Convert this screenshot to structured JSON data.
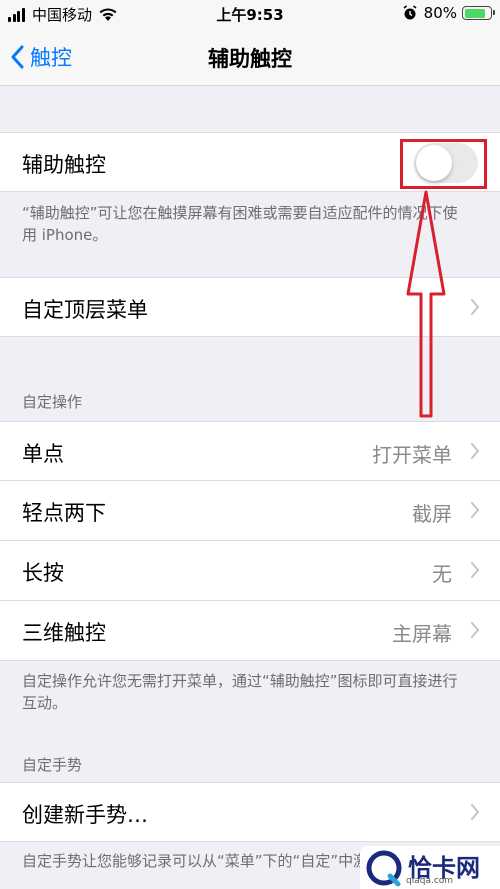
{
  "status_bar": {
    "carrier": "中国移动",
    "time": "上午9:53",
    "battery_percent": "80%",
    "battery_level": 0.8
  },
  "nav": {
    "back_label": "触控",
    "title": "辅助触控"
  },
  "assistive_touch": {
    "label": "辅助触控",
    "toggle_on": false,
    "description": "“辅助触控”可让您在触摸屏幕有困难或需要自适应配件的情况下使用 iPhone。"
  },
  "top_level_menu": {
    "label": "自定顶层菜单"
  },
  "custom_actions": {
    "header": "自定操作",
    "rows": [
      {
        "label": "单点",
        "value": "打开菜单"
      },
      {
        "label": "轻点两下",
        "value": "截屏"
      },
      {
        "label": "长按",
        "value": "无"
      },
      {
        "label": "三维触控",
        "value": "主屏幕"
      }
    ],
    "footer": "自定操作允许您无需打开菜单，通过“辅助触控”图标即可直接进行互动。"
  },
  "custom_gestures": {
    "header": "自定手势",
    "create_label": "创建新手势…",
    "footer": "自定手势让您能够记录可以从“菜单”下的“自定”中激活的手势。"
  },
  "watermark": {
    "name": "恰卡网",
    "url": "qiaqa.com"
  },
  "colors": {
    "accent": "#007aff",
    "highlight": "#d9202e",
    "background": "#f0eff5"
  }
}
